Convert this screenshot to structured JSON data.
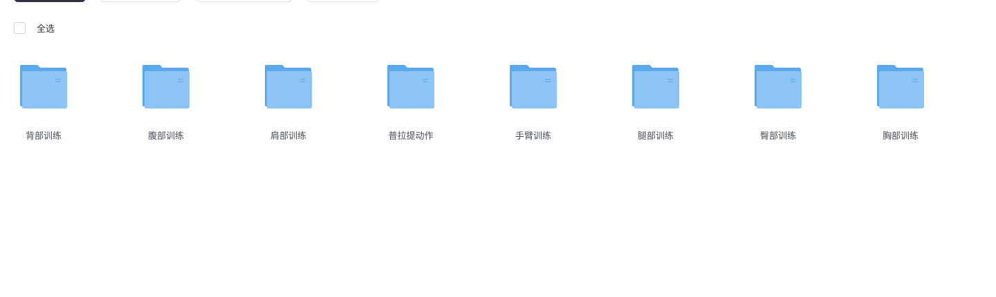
{
  "toolbar": {
    "buttons": [
      {
        "style": "primary"
      },
      {
        "style": "outline"
      },
      {
        "style": "outline"
      },
      {
        "style": "outline"
      }
    ]
  },
  "select_all": {
    "label": "全选",
    "checked": false
  },
  "folders": [
    {
      "name": "背部训练",
      "icon": "folder-icon"
    },
    {
      "name": "腹部训练",
      "icon": "folder-icon"
    },
    {
      "name": "肩部训练",
      "icon": "folder-icon"
    },
    {
      "name": "普拉提动作",
      "icon": "folder-icon"
    },
    {
      "name": "手臂训练",
      "icon": "folder-icon"
    },
    {
      "name": "腿部训练",
      "icon": "folder-icon"
    },
    {
      "name": "臀部训练",
      "icon": "folder-icon"
    },
    {
      "name": "胸部训练",
      "icon": "folder-icon"
    }
  ],
  "colors": {
    "primary_button": "#2f3042",
    "folder_back": "#5aa9ec",
    "folder_front": "#8cc4f5",
    "label_text": "#4a4f58"
  }
}
